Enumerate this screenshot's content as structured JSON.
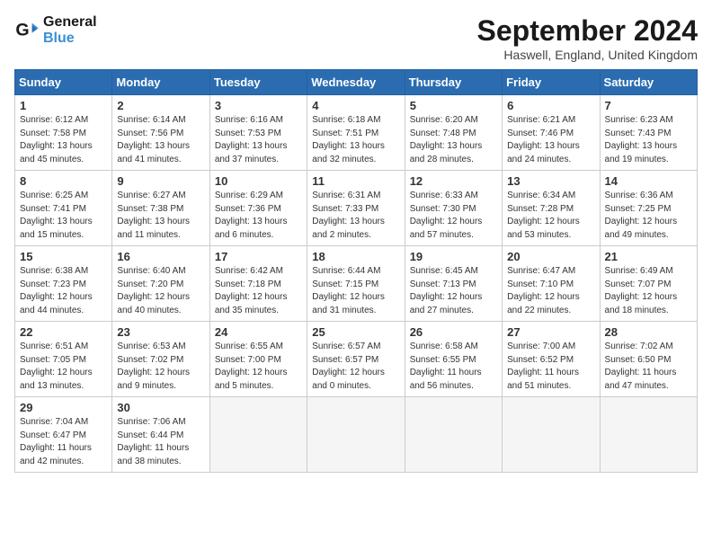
{
  "logo": {
    "line1": "General",
    "line2": "Blue"
  },
  "title": "September 2024",
  "location": "Haswell, England, United Kingdom",
  "days": [
    "Sunday",
    "Monday",
    "Tuesday",
    "Wednesday",
    "Thursday",
    "Friday",
    "Saturday"
  ],
  "weeks": [
    [
      {
        "num": "1",
        "rise": "6:12 AM",
        "set": "7:58 PM",
        "daylight": "13 hours and 45 minutes."
      },
      {
        "num": "2",
        "rise": "6:14 AM",
        "set": "7:56 PM",
        "daylight": "13 hours and 41 minutes."
      },
      {
        "num": "3",
        "rise": "6:16 AM",
        "set": "7:53 PM",
        "daylight": "13 hours and 37 minutes."
      },
      {
        "num": "4",
        "rise": "6:18 AM",
        "set": "7:51 PM",
        "daylight": "13 hours and 32 minutes."
      },
      {
        "num": "5",
        "rise": "6:20 AM",
        "set": "7:48 PM",
        "daylight": "13 hours and 28 minutes."
      },
      {
        "num": "6",
        "rise": "6:21 AM",
        "set": "7:46 PM",
        "daylight": "13 hours and 24 minutes."
      },
      {
        "num": "7",
        "rise": "6:23 AM",
        "set": "7:43 PM",
        "daylight": "13 hours and 19 minutes."
      }
    ],
    [
      {
        "num": "8",
        "rise": "6:25 AM",
        "set": "7:41 PM",
        "daylight": "13 hours and 15 minutes."
      },
      {
        "num": "9",
        "rise": "6:27 AM",
        "set": "7:38 PM",
        "daylight": "13 hours and 11 minutes."
      },
      {
        "num": "10",
        "rise": "6:29 AM",
        "set": "7:36 PM",
        "daylight": "13 hours and 6 minutes."
      },
      {
        "num": "11",
        "rise": "6:31 AM",
        "set": "7:33 PM",
        "daylight": "13 hours and 2 minutes."
      },
      {
        "num": "12",
        "rise": "6:33 AM",
        "set": "7:30 PM",
        "daylight": "12 hours and 57 minutes."
      },
      {
        "num": "13",
        "rise": "6:34 AM",
        "set": "7:28 PM",
        "daylight": "12 hours and 53 minutes."
      },
      {
        "num": "14",
        "rise": "6:36 AM",
        "set": "7:25 PM",
        "daylight": "12 hours and 49 minutes."
      }
    ],
    [
      {
        "num": "15",
        "rise": "6:38 AM",
        "set": "7:23 PM",
        "daylight": "12 hours and 44 minutes."
      },
      {
        "num": "16",
        "rise": "6:40 AM",
        "set": "7:20 PM",
        "daylight": "12 hours and 40 minutes."
      },
      {
        "num": "17",
        "rise": "6:42 AM",
        "set": "7:18 PM",
        "daylight": "12 hours and 35 minutes."
      },
      {
        "num": "18",
        "rise": "6:44 AM",
        "set": "7:15 PM",
        "daylight": "12 hours and 31 minutes."
      },
      {
        "num": "19",
        "rise": "6:45 AM",
        "set": "7:13 PM",
        "daylight": "12 hours and 27 minutes."
      },
      {
        "num": "20",
        "rise": "6:47 AM",
        "set": "7:10 PM",
        "daylight": "12 hours and 22 minutes."
      },
      {
        "num": "21",
        "rise": "6:49 AM",
        "set": "7:07 PM",
        "daylight": "12 hours and 18 minutes."
      }
    ],
    [
      {
        "num": "22",
        "rise": "6:51 AM",
        "set": "7:05 PM",
        "daylight": "12 hours and 13 minutes."
      },
      {
        "num": "23",
        "rise": "6:53 AM",
        "set": "7:02 PM",
        "daylight": "12 hours and 9 minutes."
      },
      {
        "num": "24",
        "rise": "6:55 AM",
        "set": "7:00 PM",
        "daylight": "12 hours and 5 minutes."
      },
      {
        "num": "25",
        "rise": "6:57 AM",
        "set": "6:57 PM",
        "daylight": "12 hours and 0 minutes."
      },
      {
        "num": "26",
        "rise": "6:58 AM",
        "set": "6:55 PM",
        "daylight": "11 hours and 56 minutes."
      },
      {
        "num": "27",
        "rise": "7:00 AM",
        "set": "6:52 PM",
        "daylight": "11 hours and 51 minutes."
      },
      {
        "num": "28",
        "rise": "7:02 AM",
        "set": "6:50 PM",
        "daylight": "11 hours and 47 minutes."
      }
    ],
    [
      {
        "num": "29",
        "rise": "7:04 AM",
        "set": "6:47 PM",
        "daylight": "11 hours and 42 minutes."
      },
      {
        "num": "30",
        "rise": "7:06 AM",
        "set": "6:44 PM",
        "daylight": "11 hours and 38 minutes."
      },
      null,
      null,
      null,
      null,
      null
    ]
  ]
}
